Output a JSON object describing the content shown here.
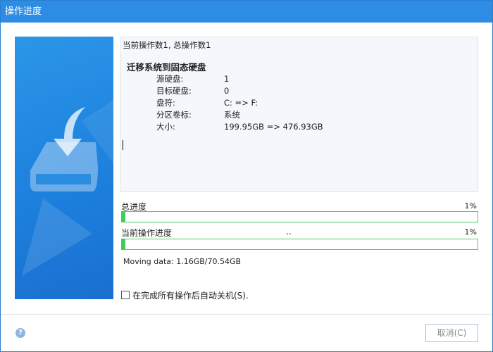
{
  "title": "操作进度",
  "log": {
    "header": "当前操作数1, 总操作数1",
    "operation": "迁移系统到固态硬盘",
    "details": [
      {
        "key": "源硬盘:",
        "value": "1"
      },
      {
        "key": "目标硬盘:",
        "value": "0"
      },
      {
        "key": "盘符:",
        "value": "C: => F:"
      },
      {
        "key": "分区卷标:",
        "value": "系统"
      },
      {
        "key": "大小:",
        "value": "199.95GB => 476.93GB"
      }
    ]
  },
  "total": {
    "label": "总进度",
    "percent_text": "1%",
    "percent": 1
  },
  "current": {
    "label": "当前操作进度",
    "status": "..",
    "percent_text": "1%",
    "percent": 1
  },
  "moving": "Moving data: 1.16GB/70.54GB",
  "shutdown_label": "在完成所有操作后自动关机(S).",
  "help": "?",
  "cancel": "取消(C)",
  "colors": {
    "accent": "#2d8de4",
    "progress": "#3ccf5c"
  }
}
